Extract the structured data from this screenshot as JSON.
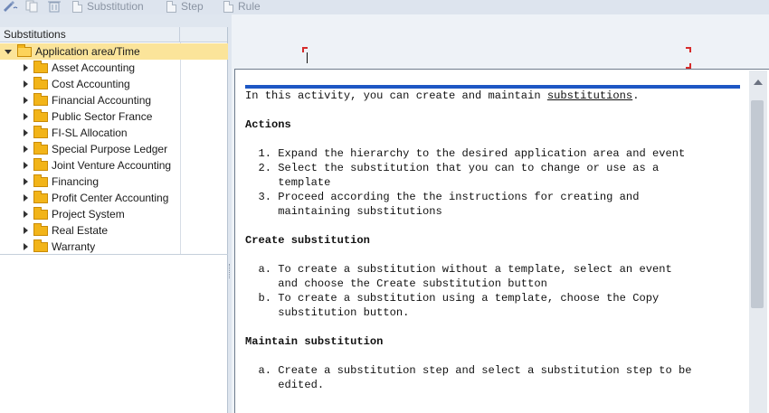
{
  "toolbar": {
    "substitution_label": "Substitution",
    "step_label": "Step",
    "rule_label": "Rule"
  },
  "tree": {
    "header": "Substitutions",
    "root": "Application area/Time",
    "items": [
      {
        "label": "Asset Accounting"
      },
      {
        "label": "Cost Accounting"
      },
      {
        "label": "Financial Accounting"
      },
      {
        "label": "Public Sector France"
      },
      {
        "label": "FI-SL Allocation"
      },
      {
        "label": "Special Purpose Ledger"
      },
      {
        "label": "Joint Venture Accounting"
      },
      {
        "label": "Financing"
      },
      {
        "label": "Profit Center Accounting"
      },
      {
        "label": "Project System"
      },
      {
        "label": "Real Estate"
      },
      {
        "label": "Warranty"
      }
    ]
  },
  "doc": {
    "intro_prefix": "In this activity, you can create and maintain ",
    "intro_link": "substitutions",
    "intro_suffix": ".",
    "actions_heading": "Actions",
    "action_1": "  1. Expand the hierarchy to the desired application area and event",
    "action_2a": "  2. Select the substitution that you can to change or use as a",
    "action_2b": "     template",
    "action_3a": "  3. Proceed according the the instructions for creating and",
    "action_3b": "     maintaining substitutions",
    "create_heading": "Create substitution",
    "create_a1": "  a. To create a substitution without a template, select an event",
    "create_a2": "     and choose the Create substitution button",
    "create_b1": "  b. To create a substitution using a template, choose the Copy",
    "create_b2": "     substitution button.",
    "maintain_heading": "Maintain substitution",
    "maintain_a1": "  a. Create a substitution step and select a substitution step to be",
    "maintain_a2": "     edited."
  }
}
